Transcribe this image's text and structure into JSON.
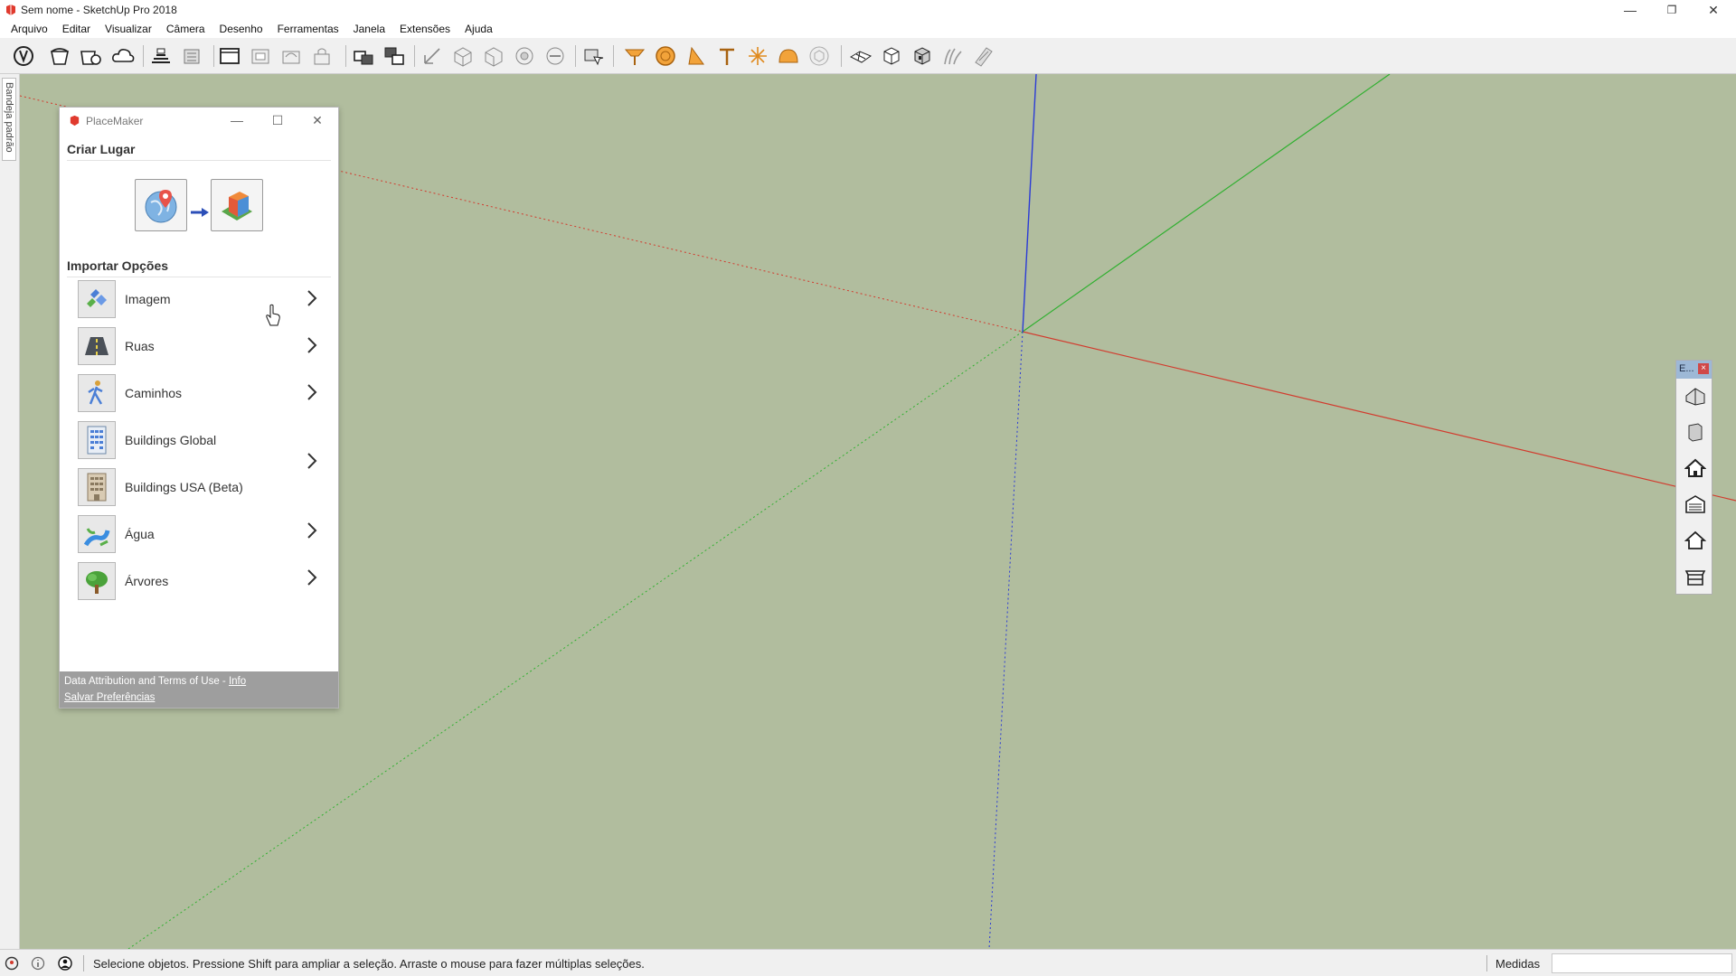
{
  "window": {
    "title": "Sem nome - SketchUp Pro 2018",
    "minimize_glyph": "—",
    "maximize_glyph": "❐",
    "close_glyph": "✕"
  },
  "menubar": {
    "items": [
      "Arquivo",
      "Editar",
      "Visualizar",
      "Câmera",
      "Desenho",
      "Ferramentas",
      "Janela",
      "Extensões",
      "Ajuda"
    ]
  },
  "toolbar": {
    "icons": [
      "select-arrow-icon",
      "paint-bucket-icon",
      "component-icon",
      "cloud-icon",
      "warehouse-icon",
      "extension-warehouse-icon",
      "layout-icon",
      "send-to-layout-icon",
      "style-icon",
      "lock-icon",
      "orbit-icon",
      "pan-icon",
      "iso-view-icon",
      "top-view-icon",
      "front-view-icon",
      "right-view-icon",
      "back-view-icon",
      "camera-icon",
      "push-pull-icon",
      "circle-icon",
      "protractor-icon",
      "tape-measure-icon",
      "axes-icon",
      "sphere-icon",
      "box-outline-icon",
      "sandbox-icon",
      "box-icon",
      "box-detail-icon",
      "grass-icon",
      "smoove-icon"
    ]
  },
  "left_tray": {
    "label": "Bandeja padrão"
  },
  "placemaker": {
    "title": "PlaceMaker",
    "minimize_glyph": "—",
    "maximize_glyph": "☐",
    "close_glyph": "✕",
    "create_section": "Criar Lugar",
    "import_section": "Importar Opções",
    "options": [
      {
        "label": "Imagem",
        "icon": "image-icon"
      },
      {
        "label": "Ruas",
        "icon": "road-icon"
      },
      {
        "label": "Caminhos",
        "icon": "pedestrian-icon"
      },
      {
        "label": "Buildings Global",
        "icon": "building-icon"
      },
      {
        "label": "Buildings USA (Beta)",
        "icon": "building-usa-icon"
      },
      {
        "label": "Água",
        "icon": "water-icon"
      },
      {
        "label": "Árvores",
        "icon": "tree-icon"
      }
    ],
    "footer": {
      "attribution": "Data Attribution and Terms of Use -",
      "info_link": "Info",
      "preferences_link": "Salvar Preferências"
    }
  },
  "ext_toolbar": {
    "title": "E...",
    "close_glyph": "×",
    "icons": [
      "house-3d-icon",
      "panel-icon",
      "home-icon",
      "garage-icon",
      "house-outline-icon",
      "carport-icon"
    ]
  },
  "statusbar": {
    "hint": "Selecione objetos. Pressione Shift para ampliar a seleção. Arraste o mouse para fazer múltiplas seleções.",
    "measurements_label": "Medidas",
    "measurements_value": ""
  },
  "colors": {
    "viewport": "#b1bd9e",
    "red_axis": "#d23b2e",
    "green_axis": "#2fb02f",
    "blue_axis": "#2b3bd6"
  }
}
